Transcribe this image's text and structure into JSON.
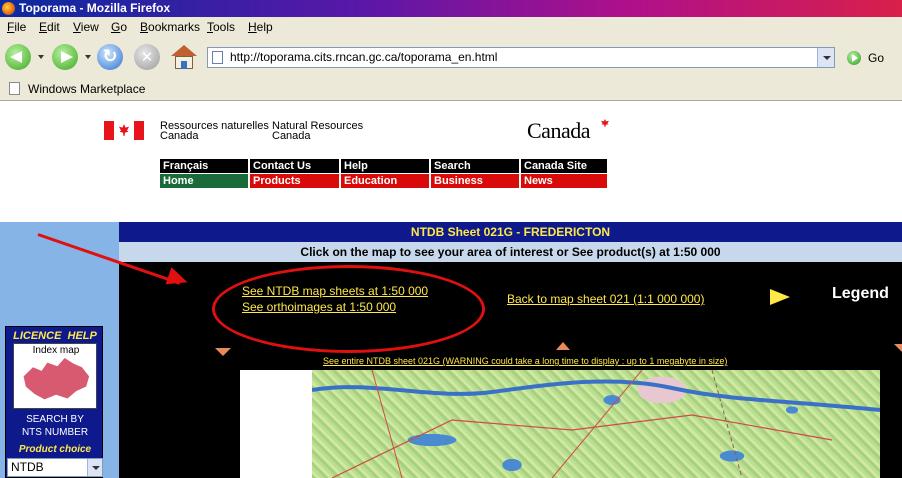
{
  "window": {
    "title": "Toporama - Mozilla Firefox"
  },
  "menu": {
    "items": [
      "File",
      "Edit",
      "View",
      "Go",
      "Bookmarks",
      "Tools",
      "Help"
    ]
  },
  "toolbar": {
    "url": "http://toporama.cits.rncan.gc.ca/toporama_en.html",
    "go_label": "Go"
  },
  "bookmarks": {
    "items": [
      "Windows Marketplace"
    ]
  },
  "header": {
    "fip_fr_line1": "Ressources naturelles",
    "fip_fr_line2": "Canada",
    "fip_en_line1": "Natural Resources",
    "fip_en_line2": "Canada",
    "wordmark": "Canada"
  },
  "nav": {
    "row1": [
      "Français",
      "Contact Us",
      "Help",
      "Search",
      "Canada Site"
    ],
    "row2": [
      "Home",
      "Products",
      "Education",
      "Business",
      "News"
    ]
  },
  "sidebar": {
    "licence": "LICENCE",
    "help": "HELP",
    "index_map": "Index map",
    "search_line1": "SEARCH BY",
    "search_line2": "NTS NUMBER",
    "product_choice": "Product choice",
    "product_value": "NTDB"
  },
  "main": {
    "sheet_title": "NTDB Sheet 021G - FREDERICTON",
    "instruction": "Click on the map to see your area of interest or See product(s) at 1:50 000",
    "link_map_sheets": "See NTDB map sheets at 1:50 000",
    "link_orthoimages": "See orthoimages at 1:50 000",
    "link_back": "Back to map sheet 021 (1:1 000 000)",
    "legend": "Legend",
    "link_entire": "See entire NTDB sheet 021G (WARNING could take a long time to display : up to 1 megabyte in size)"
  },
  "colors": {
    "nav_black": "#000000",
    "nav_red": "#d80a0a",
    "nav_green": "#1a6a3a",
    "link_yellow": "#ffe84a",
    "header_blue": "#0e1a8c",
    "annotation_red": "#e01010"
  }
}
